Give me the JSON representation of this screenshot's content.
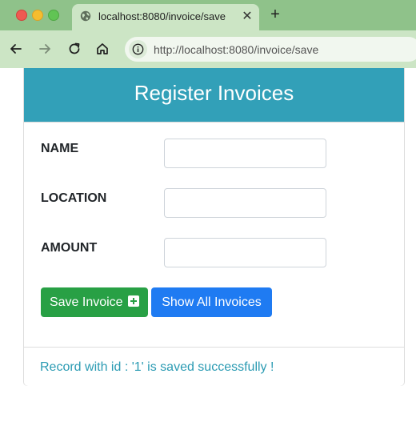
{
  "browser": {
    "tab_title": "localhost:8080/invoice/save",
    "tab_close": "✕",
    "new_tab": "+",
    "url_host": "http://localhost",
    "url_path": ":8080/invoice/save"
  },
  "page": {
    "title": "Register Invoices",
    "fields": [
      {
        "label": "NAME",
        "value": "",
        "placeholder": ""
      },
      {
        "label": "LOCATION",
        "value": "",
        "placeholder": ""
      },
      {
        "label": "AMOUNT",
        "value": "",
        "placeholder": ""
      }
    ],
    "save_button": "Save Invoice",
    "show_button": "Show All Invoices",
    "message": "Record with id : '1' is saved successfully !"
  },
  "colors": {
    "header": "#32a0b8",
    "save_button": "#28a045",
    "show_button": "#1f7bf2",
    "message": "#2b9bb3",
    "chrome": "#8fc28a"
  }
}
